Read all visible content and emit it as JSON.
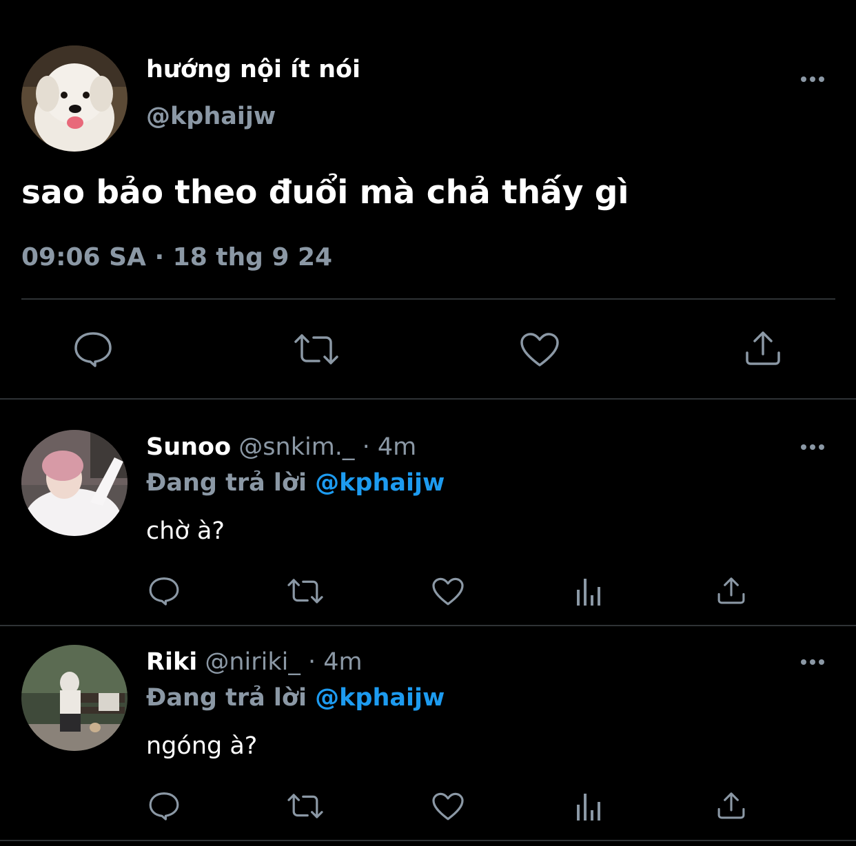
{
  "colors": {
    "background": "#000000",
    "text": "#ffffff",
    "muted": "#8b98a5",
    "link": "#1d9bf0",
    "divider": "#2f3336"
  },
  "main_tweet": {
    "display_name": "hướng nội ít nói",
    "handle": "@kphaijw",
    "text": "sao bảo theo đuổi mà chả thấy gì",
    "timestamp": "09:06 SA · 18 thg 9 24",
    "actions": [
      "reply-icon",
      "retweet-icon",
      "like-icon",
      "share-icon"
    ]
  },
  "replies": [
    {
      "display_name": "Sunoo",
      "handle": "@snkim._",
      "time": "· 4m",
      "replying_prefix": "Đang trả lời",
      "replying_to": "@kphaijw",
      "text": "chờ à?",
      "actions": [
        "reply-icon",
        "retweet-icon",
        "like-icon",
        "views-icon",
        "share-icon"
      ]
    },
    {
      "display_name": "Riki",
      "handle": "@niriki_",
      "time": "· 4m",
      "replying_prefix": "Đang trả lời",
      "replying_to": "@kphaijw",
      "text": "ngóng à?",
      "actions": [
        "reply-icon",
        "retweet-icon",
        "like-icon",
        "views-icon",
        "share-icon"
      ]
    }
  ]
}
